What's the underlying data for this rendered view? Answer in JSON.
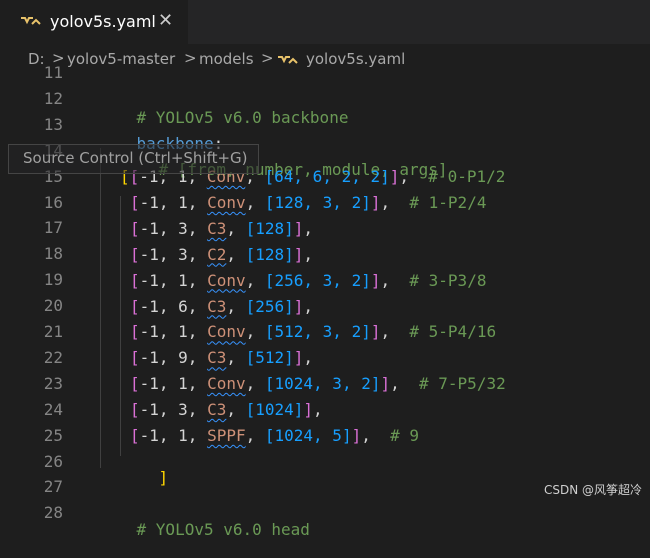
{
  "tab": {
    "label": "yolov5s.yaml",
    "close": "✕",
    "icon": "yaml-file-icon"
  },
  "breadcrumb": {
    "drive": "D:",
    "folder1": "yolov5-master",
    "folder2": "models",
    "file": "yolov5s.yaml",
    "separator": ">"
  },
  "tooltip": {
    "text": "Source Control (Ctrl+Shift+G)"
  },
  "line_numbers": [
    "11",
    "12",
    "13",
    "14",
    "15",
    "16",
    "17",
    "18",
    "19",
    "20",
    "21",
    "22",
    "23",
    "24",
    "25",
    "26",
    "27",
    "28"
  ],
  "code": {
    "l12": "# YOLOv5 v6.0 backbone",
    "l13_key": "backbone",
    "l13_colon": ":",
    "l14": "# [from, number, module, args]",
    "rows": [
      {
        "prefix": "[-1, 1, ",
        "module": "Conv",
        "args": "[64, 6, 2, 2]",
        "comment": "# 0-P1/2"
      },
      {
        "prefix": "[-1, 1, ",
        "module": "Conv",
        "args": "[128, 3, 2]",
        "comment": "# 1-P2/4"
      },
      {
        "prefix": "[-1, 3, ",
        "module": "C3",
        "args": "[128]",
        "comment": ""
      },
      {
        "prefix": "[-1, 3, ",
        "module": "C2",
        "args": "[128]",
        "comment": ""
      },
      {
        "prefix": "[-1, 1, ",
        "module": "Conv",
        "args": "[256, 3, 2]",
        "comment": "# 3-P3/8"
      },
      {
        "prefix": "[-1, 6, ",
        "module": "C3",
        "args": "[256]",
        "comment": ""
      },
      {
        "prefix": "[-1, 1, ",
        "module": "Conv",
        "args": "[512, 3, 2]",
        "comment": "# 5-P4/16"
      },
      {
        "prefix": "[-1, 9, ",
        "module": "C3",
        "args": "[512]",
        "comment": ""
      },
      {
        "prefix": "[-1, 1, ",
        "module": "Conv",
        "args": "[1024, 3, 2]",
        "comment": "# 7-P5/32"
      },
      {
        "prefix": "[-1, 3, ",
        "module": "C3",
        "args": "[1024]",
        "comment": ""
      },
      {
        "prefix": "[-1, 1, ",
        "module": "SPPF",
        "args": "[1024, 5]",
        "comment": "# 9"
      }
    ],
    "l26": "]",
    "l28": "# YOLOv5 v6.0 head"
  },
  "watermark": "CSDN @风筝超冷",
  "colors": {
    "comment": "#6a9955",
    "keyword": "#569cd6",
    "module": "#ce9178",
    "bracket_outer": "#ffd700",
    "bracket_inner": "#da70d6",
    "bracket_args": "#179fff"
  }
}
